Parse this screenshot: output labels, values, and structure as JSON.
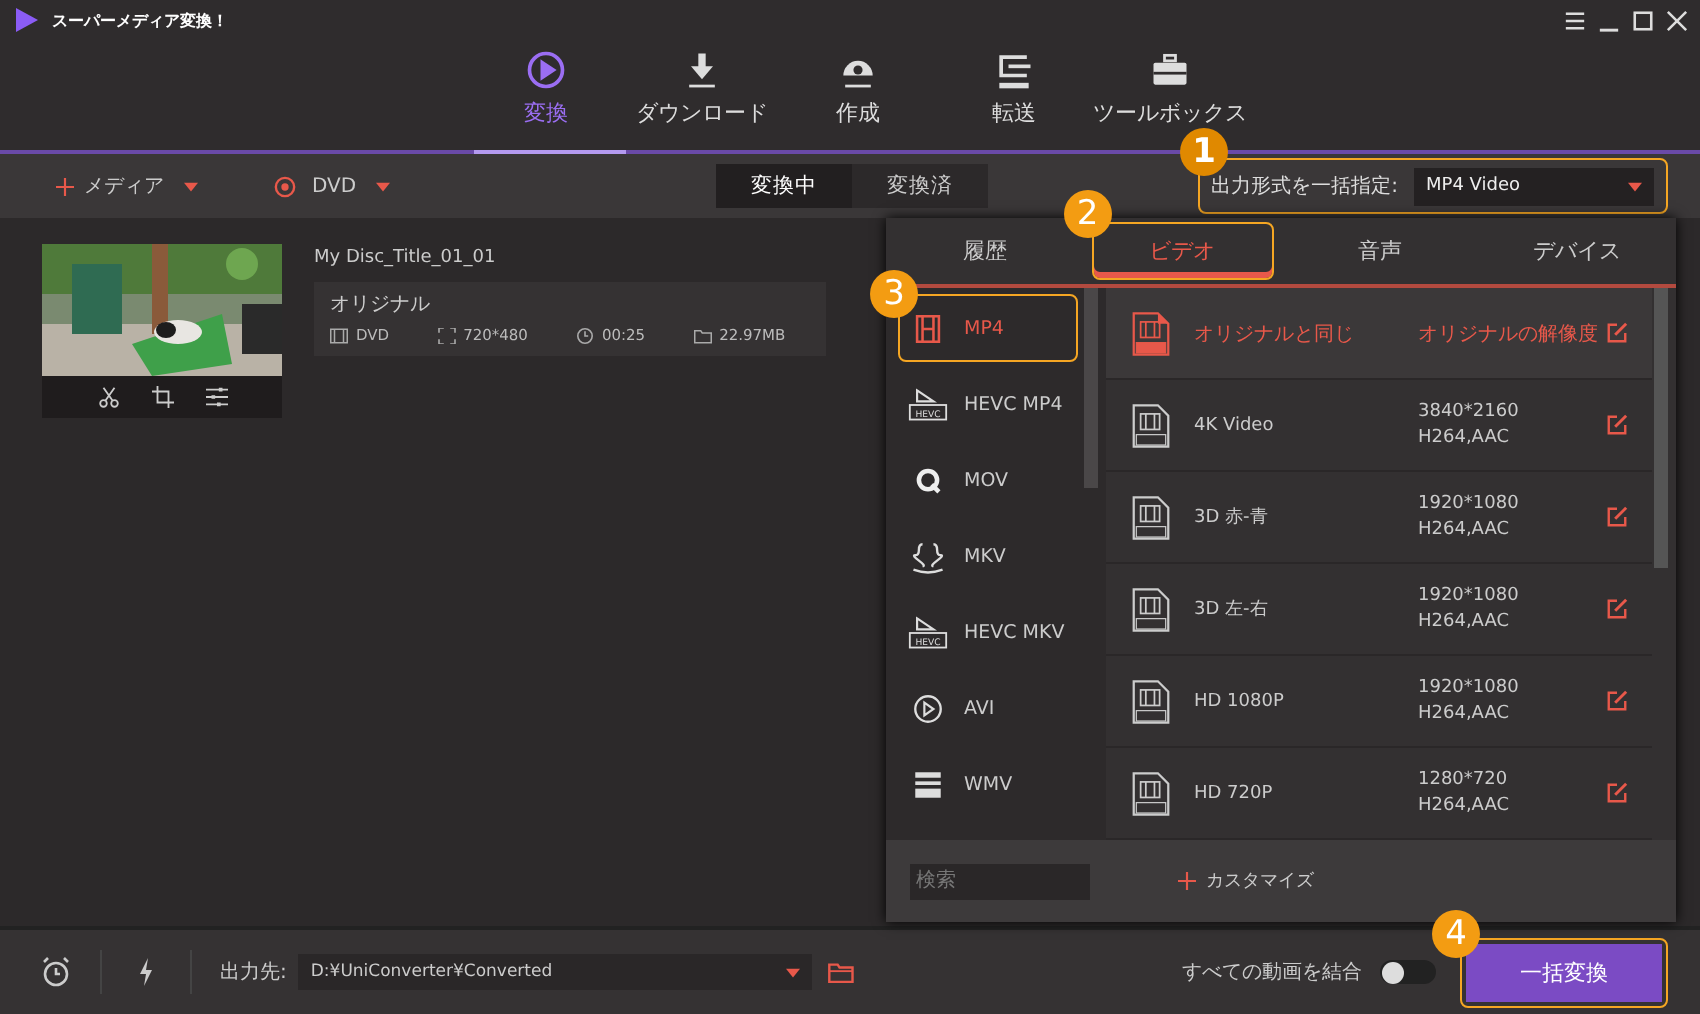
{
  "app": {
    "title": "スーパーメディア変換！"
  },
  "nav": [
    {
      "label": "変換",
      "selected": true
    },
    {
      "label": "ダウンロード",
      "selected": false
    },
    {
      "label": "作成",
      "selected": false
    },
    {
      "label": "転送",
      "selected": false
    },
    {
      "label": "ツールボックス",
      "selected": false
    }
  ],
  "toolbar": {
    "add_media": "メディア",
    "dvd": "DVD",
    "segments": [
      {
        "label": "変換中",
        "selected": true
      },
      {
        "label": "変換済",
        "selected": false
      }
    ],
    "output_format_label": "出力形式を一括指定:",
    "output_format_value": "MP4 Video",
    "callout": "1"
  },
  "file": {
    "title": "My Disc_Title_01_01",
    "source": "オリジナル",
    "format": "DVD",
    "resolution": "720*480",
    "duration": "00:25",
    "size": "22.97MB"
  },
  "format_panel": {
    "tabs": [
      {
        "label": "履歴",
        "selected": false
      },
      {
        "label": "ビデオ",
        "selected": true,
        "callout": "2"
      },
      {
        "label": "音声",
        "selected": false
      },
      {
        "label": "デバイス",
        "selected": false
      }
    ],
    "formats": [
      {
        "label": "MP4",
        "selected": true,
        "callout": "3"
      },
      {
        "label": "HEVC MP4",
        "icon_label": "HEVC",
        "selected": false
      },
      {
        "label": "MOV",
        "selected": false
      },
      {
        "label": "MKV",
        "selected": false
      },
      {
        "label": "HEVC MKV",
        "icon_label": "HEVC",
        "selected": false
      },
      {
        "label": "AVI",
        "selected": false
      },
      {
        "label": "WMV",
        "selected": false
      }
    ],
    "presets": [
      {
        "name": "オリジナルと同じ",
        "resolution": "オリジナルの解像度",
        "selected": true
      },
      {
        "name": "4K Video",
        "resolution": "3840*2160",
        "codec": "H264,AAC",
        "selected": false
      },
      {
        "name": "3D 赤-青",
        "resolution": "1920*1080",
        "codec": "H264,AAC",
        "selected": false
      },
      {
        "name": "3D 左-右",
        "resolution": "1920*1080",
        "codec": "H264,AAC",
        "selected": false
      },
      {
        "name": "HD 1080P",
        "resolution": "1920*1080",
        "codec": "H264,AAC",
        "selected": false
      },
      {
        "name": "HD 720P",
        "resolution": "1280*720",
        "codec": "H264,AAC",
        "selected": false
      }
    ],
    "search_placeholder": "検索",
    "customize": "カスタマイズ"
  },
  "bottom": {
    "output_label": "出力先:",
    "output_path": "D:¥UniConverter¥Converted",
    "merge_label": "すべての動画を結合",
    "merge_on": false,
    "convert_all": "一括変換",
    "callout": "4"
  }
}
